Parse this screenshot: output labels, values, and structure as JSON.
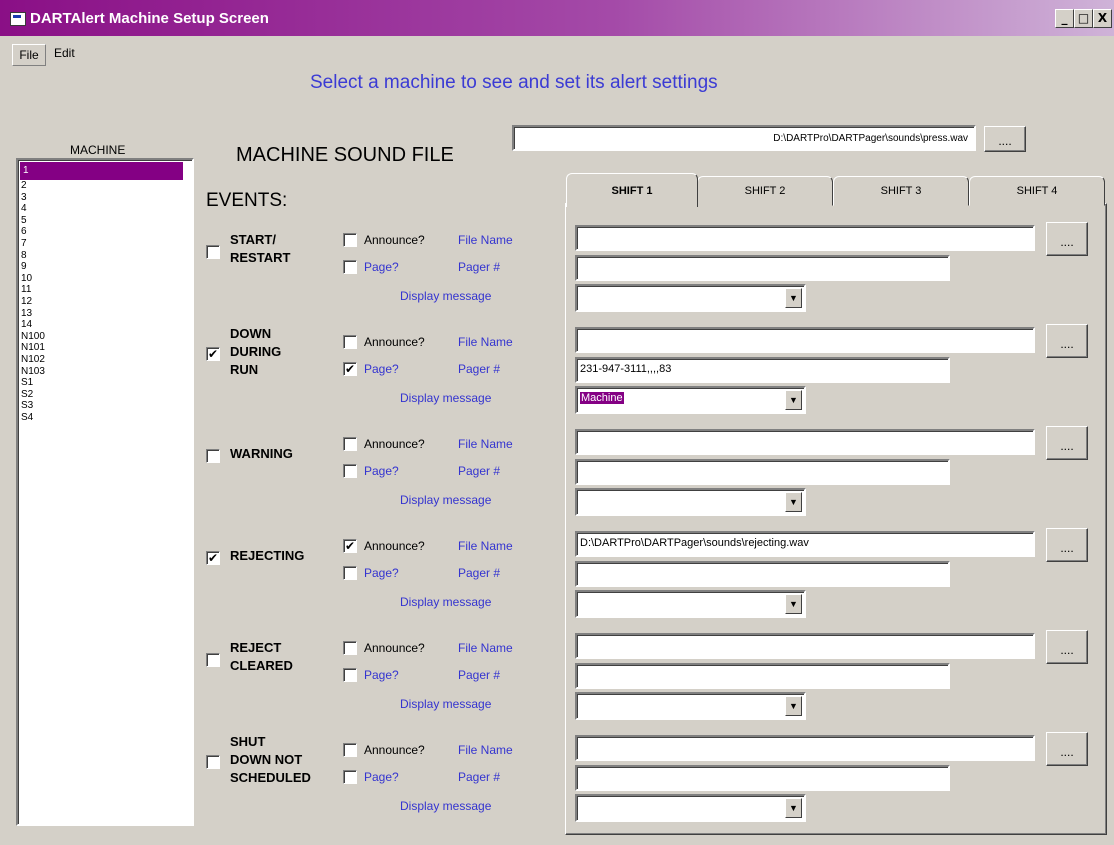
{
  "window": {
    "title": "DARTAlert Machine Setup Screen",
    "minimize": "_",
    "maximize": "□",
    "close": "X"
  },
  "menu": {
    "file": "File",
    "edit": "Edit"
  },
  "headline": "Select a machine to see and set its alert settings",
  "machine_label": "MACHINE",
  "sound": {
    "label": "MACHINE SOUND FILE",
    "value": "D:\\DARTPro\\DARTPager\\sounds\\press.wav",
    "browse": "...."
  },
  "machines": [
    "1",
    "2",
    "3",
    "4",
    "5",
    "6",
    "7",
    "8",
    "9",
    "10",
    "11",
    "12",
    "13",
    "14",
    "N100",
    "N101",
    "N102",
    "N103",
    "S1",
    "S2",
    "S3",
    "S4"
  ],
  "selected_machine": "1",
  "events_title": "EVENTS:",
  "labels": {
    "announce": "Announce?",
    "file_name": "File Name",
    "page": "Page?",
    "pager": "Pager #",
    "display": "Display message",
    "browse": "...."
  },
  "tabs": [
    "SHIFT 1",
    "SHIFT 2",
    "SHIFT 3",
    "SHIFT 4"
  ],
  "events": [
    {
      "name": [
        "START/",
        "RESTART"
      ],
      "enabled": false,
      "announce": false,
      "page": false,
      "file": "",
      "pager": "",
      "message": ""
    },
    {
      "name": [
        "DOWN",
        "DURING",
        "RUN"
      ],
      "enabled": true,
      "announce": false,
      "page": true,
      "file": "",
      "pager": "231-947-3111,,,,83",
      "message": "Machine"
    },
    {
      "name": [
        "WARNING"
      ],
      "enabled": false,
      "announce": false,
      "page": false,
      "file": "",
      "pager": "",
      "message": ""
    },
    {
      "name": [
        "REJECTING"
      ],
      "enabled": true,
      "announce": true,
      "page": false,
      "file": "D:\\DARTPro\\DARTPager\\sounds\\rejecting.wav",
      "pager": "",
      "message": ""
    },
    {
      "name": [
        "REJECT",
        "CLEARED"
      ],
      "enabled": false,
      "announce": false,
      "page": false,
      "file": "",
      "pager": "",
      "message": ""
    },
    {
      "name": [
        "SHUT",
        "DOWN NOT",
        "SCHEDULED"
      ],
      "enabled": false,
      "announce": false,
      "page": false,
      "file": "",
      "pager": "",
      "message": ""
    }
  ],
  "check_mark": "✔",
  "dropdown_arrow": "▼"
}
